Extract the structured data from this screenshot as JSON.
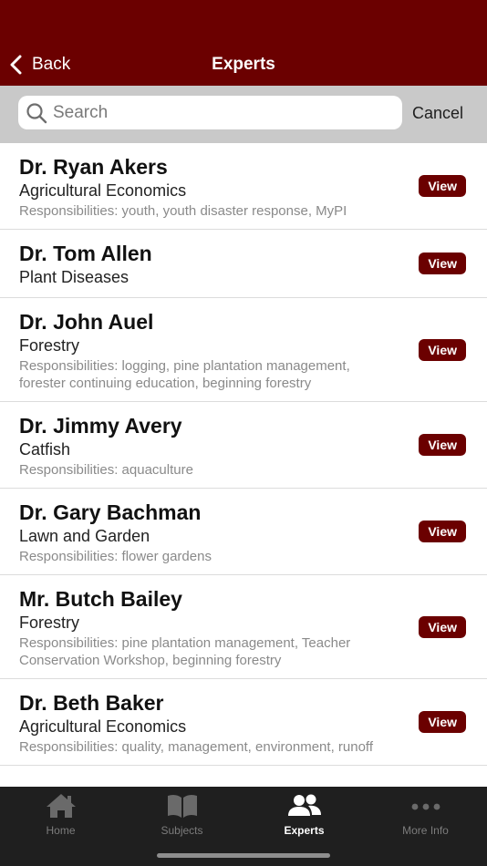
{
  "nav": {
    "back_label": "Back",
    "title": "Experts"
  },
  "search": {
    "placeholder": "Search",
    "cancel_label": "Cancel"
  },
  "experts": [
    {
      "name": "Dr. Ryan Akers",
      "subject": "Agricultural Economics",
      "responsibilities": "Responsibilities: youth, youth disaster response, MyPI",
      "view_label": "View"
    },
    {
      "name": "Dr. Tom Allen",
      "subject": "Plant Diseases",
      "responsibilities": "",
      "view_label": "View"
    },
    {
      "name": "Dr. John Auel",
      "subject": "Forestry",
      "responsibilities": "Responsibilities: logging, pine plantation management, forester continuing education, beginning forestry",
      "view_label": "View"
    },
    {
      "name": "Dr. Jimmy Avery",
      "subject": "Catfish",
      "responsibilities": "Responsibilities: aquaculture",
      "view_label": "View"
    },
    {
      "name": "Dr. Gary Bachman",
      "subject": "Lawn and Garden",
      "responsibilities": "Responsibilities: flower gardens",
      "view_label": "View"
    },
    {
      "name": "Mr. Butch Bailey",
      "subject": "Forestry",
      "responsibilities": "Responsibilities: pine plantation management, Teacher Conservation Workshop, beginning forestry",
      "view_label": "View"
    },
    {
      "name": "Dr. Beth Baker",
      "subject": "Agricultural Economics",
      "responsibilities": "Responsibilities: quality, management, environment, runoff",
      "view_label": "View"
    }
  ],
  "tabs": [
    {
      "label": "Home",
      "icon": "home-icon",
      "active": false
    },
    {
      "label": "Subjects",
      "icon": "book-icon",
      "active": false
    },
    {
      "label": "Experts",
      "icon": "people-icon",
      "active": true
    },
    {
      "label": "More Info",
      "icon": "more-icon",
      "active": false
    }
  ],
  "colors": {
    "brand": "#6b0000",
    "tabbar": "#1f1f1f",
    "searchbar_bg": "#c9c9c9"
  }
}
